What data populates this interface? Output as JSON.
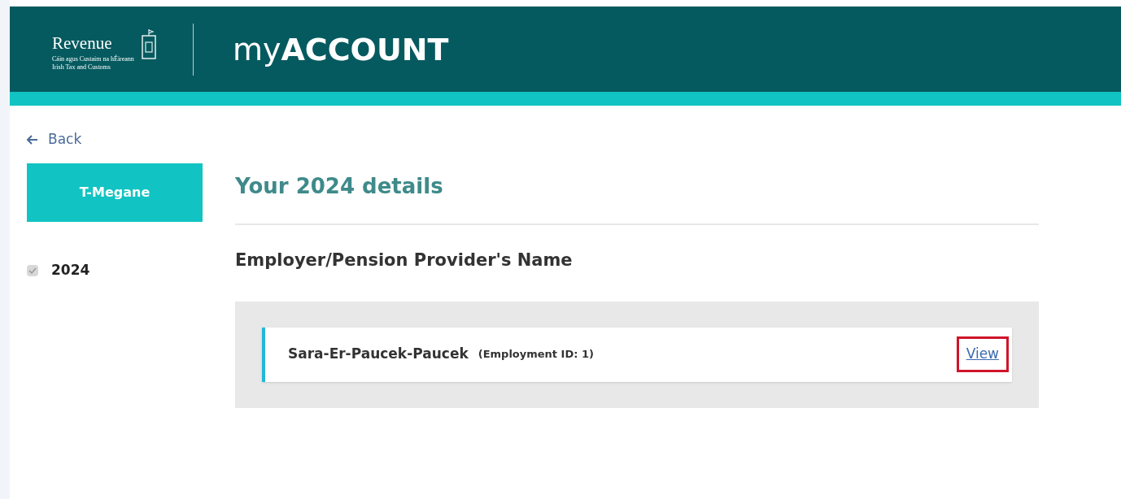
{
  "header": {
    "logo": {
      "name": "Revenue",
      "irish_line": "Cáin agus Custaim na hÉireann",
      "english_line": "Irish Tax and Customs"
    },
    "brand": {
      "light": "my",
      "bold": "ACCOUNT"
    }
  },
  "back_link": "Back",
  "sidebar": {
    "profile_button": "T-Megane",
    "items": [
      {
        "label": "2024",
        "checked": true,
        "disabled": true
      }
    ]
  },
  "main": {
    "title": "Your 2024 details",
    "section_heading": "Employer/Pension Provider's Name",
    "employments": [
      {
        "name": "Sara-Er-Paucek-Paucek",
        "id_label": "(Employment ID: 1)",
        "link": "View",
        "highlighted": true
      }
    ]
  }
}
